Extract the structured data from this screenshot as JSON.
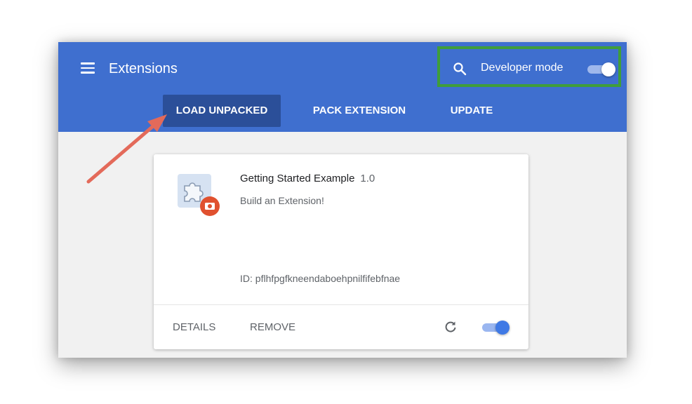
{
  "header": {
    "menu_icon": "hamburger-menu-icon",
    "title": "Extensions",
    "search_icon": "search-icon",
    "developer_mode_label": "Developer mode",
    "developer_mode_on": true
  },
  "toolbar": {
    "load_unpacked_label": "LOAD UNPACKED",
    "pack_extension_label": "PACK EXTENSION",
    "update_label": "UPDATE"
  },
  "extension": {
    "name": "Getting Started Example",
    "version": "1.0",
    "description": "Build an Extension!",
    "id_text": "ID: pflhfpgfkneendaboehpnilfifebfnae",
    "details_label": "DETAILS",
    "remove_label": "REMOVE",
    "reload_icon": "reload-icon",
    "enabled": true,
    "icon": "puzzle-piece-icon"
  },
  "colors": {
    "toolbar_blue": "#3f6fcf",
    "load_unpacked_bg": "#2b4f99",
    "highlight_green": "#3f9d3a",
    "annotation_arrow": "#e36a5a",
    "toggle_blue": "#3f79e5"
  }
}
